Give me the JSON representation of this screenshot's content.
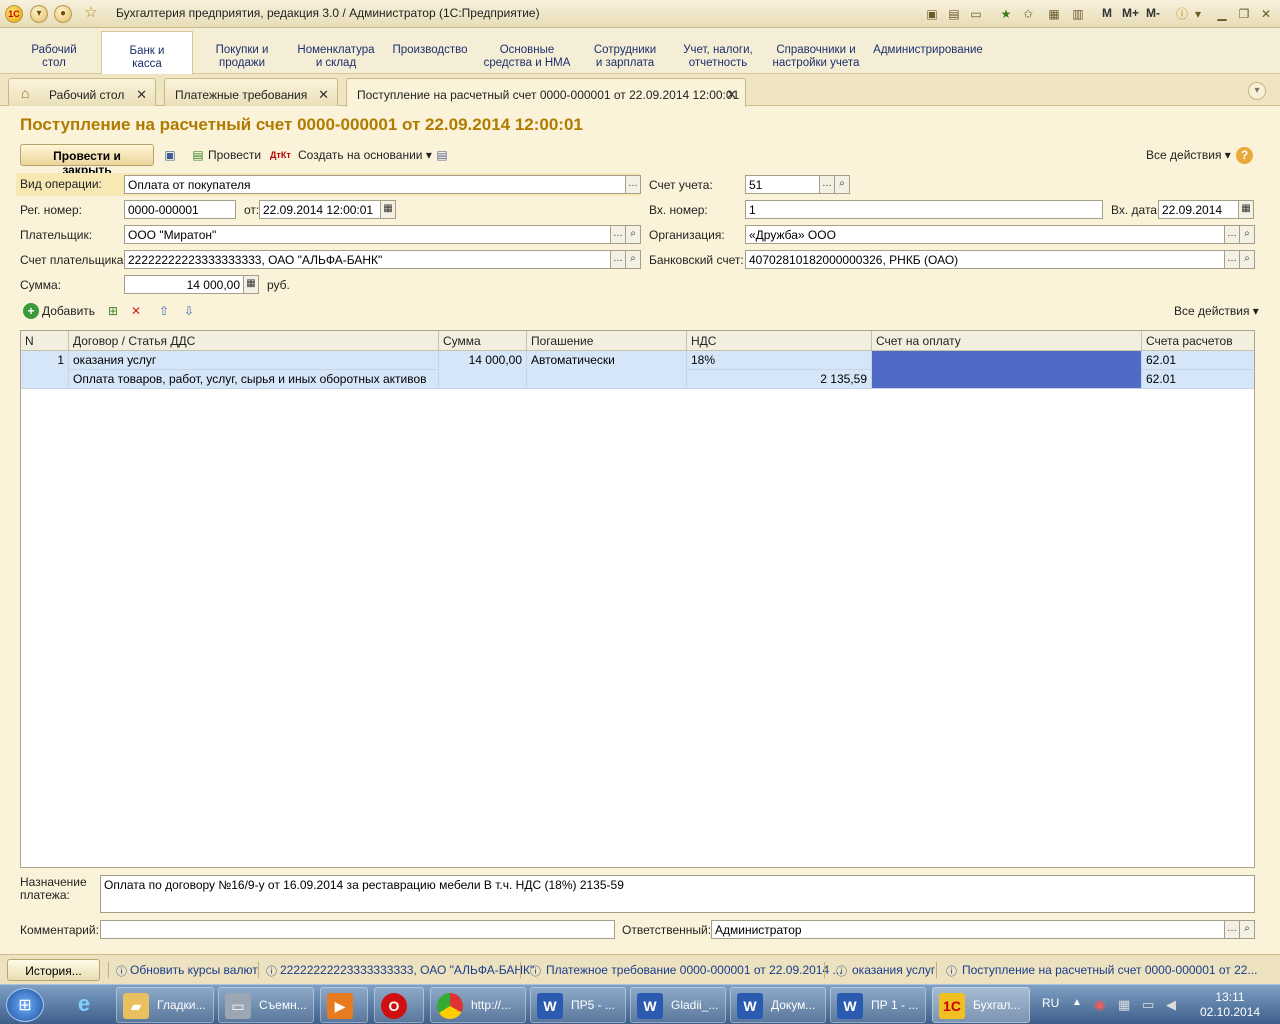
{
  "window": {
    "title": "Бухгалтерия предприятия, редакция 3.0 / Администратор  (1С:Предприятие)",
    "m": "M",
    "mplus": "M+",
    "mminus": "M-"
  },
  "sections": [
    {
      "label1": "Рабочий",
      "label2": "стол"
    },
    {
      "label1": "Банк и",
      "label2": "касса"
    },
    {
      "label1": "Покупки и",
      "label2": "продажи"
    },
    {
      "label1": "Номенклатура",
      "label2": "и склад"
    },
    {
      "label1": "Производство",
      "label2": ""
    },
    {
      "label1": "Основные",
      "label2": "средства и НМА"
    },
    {
      "label1": "Сотрудники",
      "label2": "и зарплата"
    },
    {
      "label1": "Учет, налоги,",
      "label2": "отчетность"
    },
    {
      "label1": "Справочники и",
      "label2": "настройки учета"
    },
    {
      "label1": "Администрирование",
      "label2": ""
    }
  ],
  "tabs": [
    {
      "label": "Рабочий стол"
    },
    {
      "label": "Платежные требования"
    },
    {
      "label": "Поступление на расчетный счет 0000-000001 от 22.09.2014 12:00:01"
    }
  ],
  "form": {
    "title": "Поступление на расчетный счет 0000-000001 от 22.09.2014 12:00:01",
    "toolbar": {
      "post_close": "Провести и закрыть",
      "post": "Провести",
      "create_based": "Создать на основании",
      "all_actions": "Все действия"
    },
    "labels": {
      "op_type": "Вид операции:",
      "reg_no": "Рег. номер:",
      "from": "от:",
      "payer": "Плательщик:",
      "payer_account": "Счет плательщика:",
      "sum": "Сумма:",
      "rub": "руб.",
      "account": "Счет учета:",
      "in_no": "Вх. номер:",
      "in_date": "Вх. дата:",
      "org": "Организация:",
      "bank_account": "Банковский счет:"
    },
    "values": {
      "op_type": "Оплата от покупателя",
      "reg_no": "0000-000001",
      "date": "22.09.2014 12:00:01",
      "payer": "ООО \"Миратон\"",
      "payer_account": "22222222223333333333, ОАО \"АЛЬФА-БАНК\"",
      "sum": "14 000,00",
      "account": "51",
      "in_no": "1",
      "in_date": "22.09.2014",
      "org": "«Дружба» ООО",
      "bank_account": "40702810182000000326, РНКБ (ОАО)"
    },
    "table_toolbar": {
      "add": "Добавить",
      "all_actions": "Все действия"
    },
    "table": {
      "columns": [
        "N",
        "Договор / Статья ДДС",
        "Сумма",
        "Погашение задолженности",
        "НДС",
        "Счет на оплату",
        "Счета расчетов"
      ],
      "row": {
        "n": "1",
        "contract": "оказания услуг",
        "dds": "Оплата товаров, работ, услуг, сырья и иных оборотных активов",
        "sum": "14 000,00",
        "repay": "Автоматически",
        "vat_rate": "18%",
        "vat_sum": "2 135,59",
        "invoice": "",
        "acc1": "62.01",
        "acc2": "62.01"
      }
    },
    "purpose_label1": "Назначение",
    "purpose_label2": "платежа:",
    "purpose": "Оплата по договору №16/9-у  от 16.09.2014 за реставрацию мебели В т.ч. НДС  (18%) 2135-59",
    "comment_label": "Комментарий:",
    "comment": "",
    "responsible_label": "Ответственный:",
    "responsible": "Администратор"
  },
  "statusbar": {
    "history": "История...",
    "items": [
      "Обновить курсы валют",
      "22222222223333333333, ОАО \"АЛЬФА-БАНК\"",
      "Платежное требование 0000-000001 от 22.09.2014 ...",
      "оказания услуг",
      "Поступление на расчетный счет 0000-000001 от 22..."
    ]
  },
  "taskbar": {
    "items": [
      "Гладки...",
      "Съемн...",
      "",
      "",
      "http://...",
      "ПР5 - ...",
      "Gladii_...",
      "Докум...",
      "ПР 1 - ...",
      "Бухгал..."
    ],
    "lang": "RU",
    "time": "13:11",
    "date": "02.10.2014"
  }
}
